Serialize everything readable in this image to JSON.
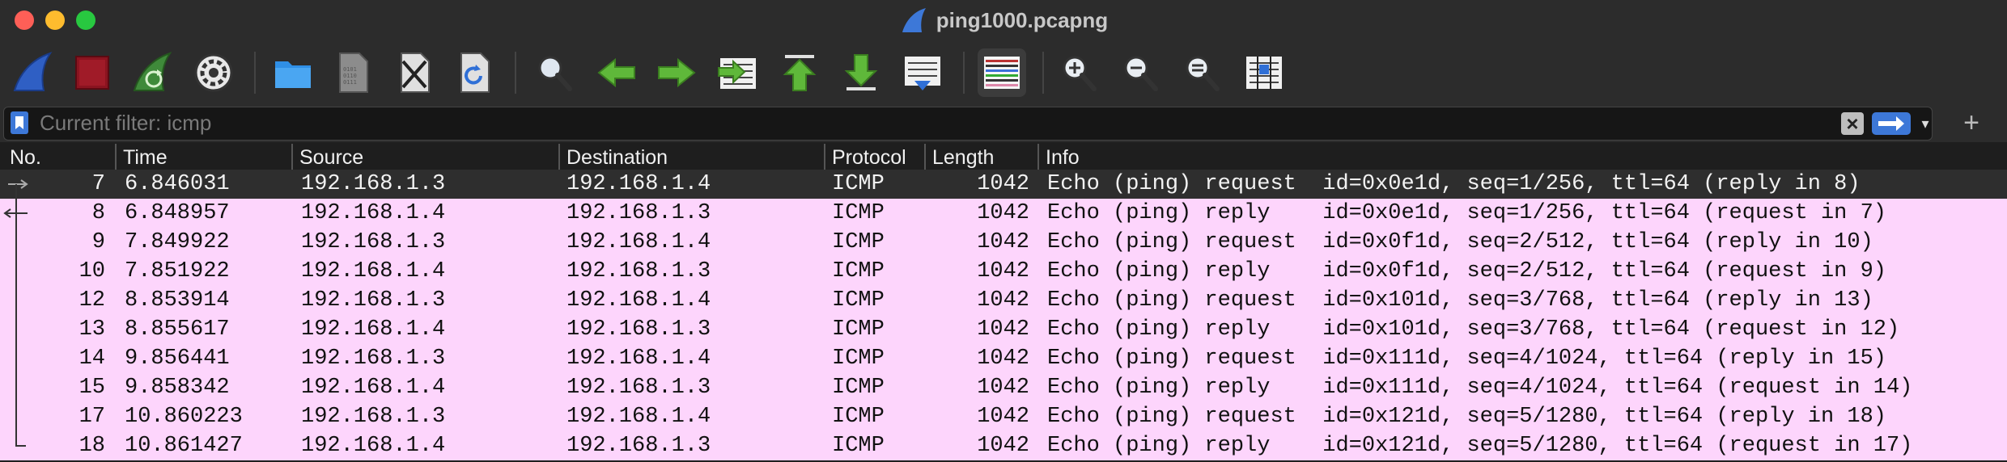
{
  "window": {
    "title": "ping1000.pcapng"
  },
  "toolbar": {
    "buttons": [
      {
        "icon": "shark-fin-start-icon"
      },
      {
        "icon": "stop-capture-icon"
      },
      {
        "icon": "restart-capture-icon"
      },
      {
        "icon": "capture-options-icon"
      },
      {
        "icon": "open-folder-icon"
      },
      {
        "icon": "save-file-icon"
      },
      {
        "icon": "close-file-icon"
      },
      {
        "icon": "reload-file-icon"
      },
      {
        "icon": "find-packet-icon"
      },
      {
        "icon": "go-back-icon"
      },
      {
        "icon": "go-forward-icon"
      },
      {
        "icon": "go-to-packet-icon"
      },
      {
        "icon": "first-packet-icon"
      },
      {
        "icon": "last-packet-icon"
      },
      {
        "icon": "auto-scroll-icon"
      },
      {
        "icon": "colorize-icon"
      },
      {
        "icon": "zoom-in-icon"
      },
      {
        "icon": "zoom-out-icon"
      },
      {
        "icon": "normal-size-icon"
      },
      {
        "icon": "resize-columns-icon"
      }
    ]
  },
  "filter": {
    "placeholder": "Current filter: icmp",
    "value": "",
    "clear_label": "×",
    "add_label": "+"
  },
  "columns": {
    "no": "No.",
    "time": "Time",
    "source": "Source",
    "destination": "Destination",
    "protocol": "Protocol",
    "length": "Length",
    "info": "Info"
  },
  "packets": [
    {
      "no": "7",
      "time": "6.846031",
      "src": "192.168.1.3",
      "dst": "192.168.1.4",
      "proto": "ICMP",
      "len": "1042",
      "info": "Echo (ping) request  id=0x0e1d, seq=1/256, ttl=64 (reply in 8)",
      "selected": true
    },
    {
      "no": "8",
      "time": "6.848957",
      "src": "192.168.1.4",
      "dst": "192.168.1.3",
      "proto": "ICMP",
      "len": "1042",
      "info": "Echo (ping) reply    id=0x0e1d, seq=1/256, ttl=64 (request in 7)",
      "selected": false
    },
    {
      "no": "9",
      "time": "7.849922",
      "src": "192.168.1.3",
      "dst": "192.168.1.4",
      "proto": "ICMP",
      "len": "1042",
      "info": "Echo (ping) request  id=0x0f1d, seq=2/512, ttl=64 (reply in 10)",
      "selected": false
    },
    {
      "no": "10",
      "time": "7.851922",
      "src": "192.168.1.4",
      "dst": "192.168.1.3",
      "proto": "ICMP",
      "len": "1042",
      "info": "Echo (ping) reply    id=0x0f1d, seq=2/512, ttl=64 (request in 9)",
      "selected": false
    },
    {
      "no": "12",
      "time": "8.853914",
      "src": "192.168.1.3",
      "dst": "192.168.1.4",
      "proto": "ICMP",
      "len": "1042",
      "info": "Echo (ping) request  id=0x101d, seq=3/768, ttl=64 (reply in 13)",
      "selected": false
    },
    {
      "no": "13",
      "time": "8.855617",
      "src": "192.168.1.4",
      "dst": "192.168.1.3",
      "proto": "ICMP",
      "len": "1042",
      "info": "Echo (ping) reply    id=0x101d, seq=3/768, ttl=64 (request in 12)",
      "selected": false
    },
    {
      "no": "14",
      "time": "9.856441",
      "src": "192.168.1.3",
      "dst": "192.168.1.4",
      "proto": "ICMP",
      "len": "1042",
      "info": "Echo (ping) request  id=0x111d, seq=4/1024, ttl=64 (reply in 15)",
      "selected": false
    },
    {
      "no": "15",
      "time": "9.858342",
      "src": "192.168.1.4",
      "dst": "192.168.1.3",
      "proto": "ICMP",
      "len": "1042",
      "info": "Echo (ping) reply    id=0x111d, seq=4/1024, ttl=64 (request in 14)",
      "selected": false
    },
    {
      "no": "17",
      "time": "10.860223",
      "src": "192.168.1.3",
      "dst": "192.168.1.4",
      "proto": "ICMP",
      "len": "1042",
      "info": "Echo (ping) request  id=0x121d, seq=5/1280, ttl=64 (reply in 18)",
      "selected": false
    },
    {
      "no": "18",
      "time": "10.861427",
      "src": "192.168.1.4",
      "dst": "192.168.1.3",
      "proto": "ICMP",
      "len": "1042",
      "info": "Echo (ping) reply    id=0x121d, seq=5/1280, ttl=64 (request in 17)",
      "selected": false
    }
  ],
  "colors": {
    "icmp_row": "#fdd5fc",
    "selected_row": "#2e2e2e",
    "accent": "#3d78d8"
  }
}
